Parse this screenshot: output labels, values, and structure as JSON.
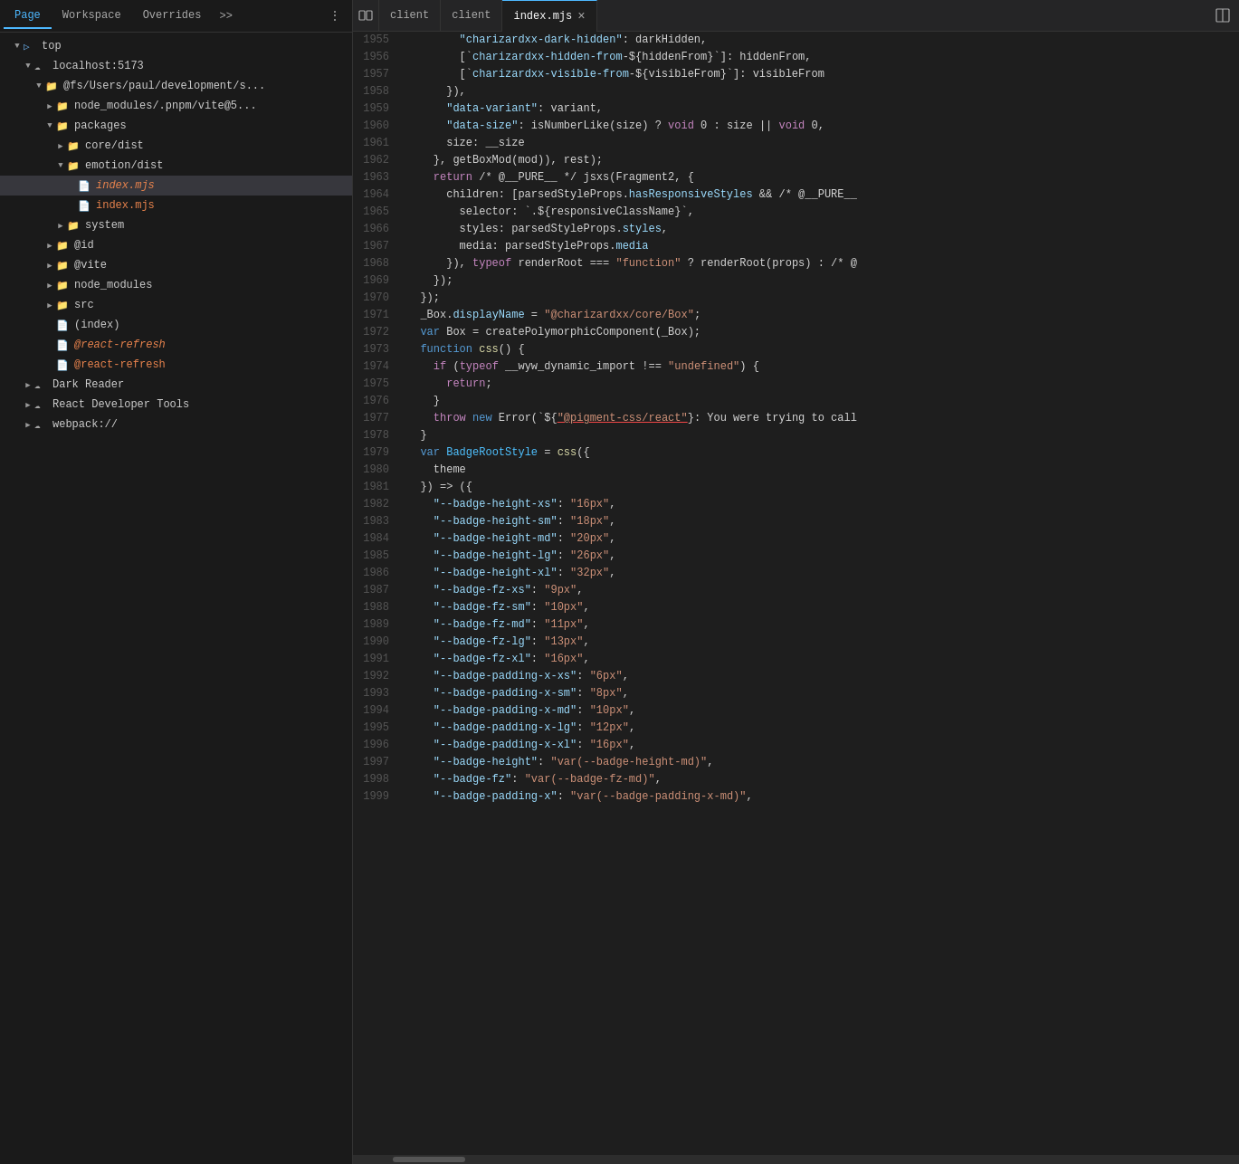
{
  "tabs": {
    "items": [
      {
        "label": "Page",
        "active": true
      },
      {
        "label": "Workspace",
        "active": false
      },
      {
        "label": "Overrides",
        "active": false
      }
    ],
    "more": ">>",
    "dots": "⋮"
  },
  "fileTree": {
    "items": [
      {
        "indent": 0,
        "arrow": "▼",
        "icon": "folder",
        "label": "top",
        "selected": false
      },
      {
        "indent": 1,
        "arrow": "▼",
        "icon": "cloud",
        "label": "localhost:5173",
        "selected": false
      },
      {
        "indent": 2,
        "arrow": "▼",
        "icon": "folder",
        "label": "@fs/Users/paul/development/s...",
        "selected": false
      },
      {
        "indent": 3,
        "arrow": "▶",
        "icon": "folder",
        "label": "node_modules/.pnpm/vite@5...",
        "selected": false
      },
      {
        "indent": 3,
        "arrow": "▼",
        "icon": "folder",
        "label": "packages",
        "selected": false
      },
      {
        "indent": 4,
        "arrow": "▶",
        "icon": "folder",
        "label": "core/dist",
        "selected": false
      },
      {
        "indent": 4,
        "arrow": "▼",
        "icon": "folder",
        "label": "emotion/dist",
        "selected": false
      },
      {
        "indent": 5,
        "arrow": "",
        "icon": "file-orange",
        "label": "index.mjs",
        "selected": true,
        "italic": true
      },
      {
        "indent": 5,
        "arrow": "",
        "icon": "file-orange",
        "label": "index.mjs",
        "selected": false
      },
      {
        "indent": 4,
        "arrow": "▶",
        "icon": "folder",
        "label": "system",
        "selected": false
      },
      {
        "indent": 3,
        "arrow": "▶",
        "icon": "folder",
        "label": "@id",
        "selected": false
      },
      {
        "indent": 3,
        "arrow": "▶",
        "icon": "folder",
        "label": "@vite",
        "selected": false
      },
      {
        "indent": 3,
        "arrow": "▶",
        "icon": "folder",
        "label": "node_modules",
        "selected": false
      },
      {
        "indent": 3,
        "arrow": "▶",
        "icon": "folder",
        "label": "src",
        "selected": false
      },
      {
        "indent": 3,
        "arrow": "",
        "icon": "file",
        "label": "(index)",
        "selected": false
      },
      {
        "indent": 3,
        "arrow": "",
        "icon": "file-orange",
        "label": "@react-refresh",
        "selected": false,
        "italic": true
      },
      {
        "indent": 3,
        "arrow": "",
        "icon": "file-orange",
        "label": "@react-refresh",
        "selected": false
      },
      {
        "indent": 1,
        "arrow": "▶",
        "icon": "cloud",
        "label": "Dark Reader",
        "selected": false
      },
      {
        "indent": 1,
        "arrow": "▶",
        "icon": "cloud",
        "label": "React Developer Tools",
        "selected": false
      },
      {
        "indent": 1,
        "arrow": "▶",
        "icon": "cloud",
        "label": "webpack://",
        "selected": false
      }
    ]
  },
  "editorTabs": {
    "layoutIcon": "⊞",
    "tabs": [
      {
        "label": "client",
        "active": false,
        "closable": false
      },
      {
        "label": "client",
        "active": false,
        "closable": false
      },
      {
        "label": "index.mjs",
        "active": true,
        "closable": true
      }
    ]
  },
  "codeLines": [
    {
      "num": 1955,
      "content": [
        {
          "t": "        ",
          "c": ""
        },
        {
          "t": "\"charizardxx-dark-hidden\"",
          "c": "s-key"
        },
        {
          "t": ": darkHidden,",
          "c": "s-white"
        }
      ]
    },
    {
      "num": 1956,
      "content": [
        {
          "t": "        [`",
          "c": "s-white"
        },
        {
          "t": "charizardxx-hidden-from",
          "c": "s-key"
        },
        {
          "t": "-${hiddenFrom}`]: hiddenFrom,",
          "c": "s-white"
        }
      ]
    },
    {
      "num": 1957,
      "content": [
        {
          "t": "        [`",
          "c": "s-white"
        },
        {
          "t": "charizardxx-visible-from",
          "c": "s-key"
        },
        {
          "t": "-${visibleFrom}`]: visibleFrom",
          "c": "s-white"
        }
      ]
    },
    {
      "num": 1958,
      "content": [
        {
          "t": "      }),",
          "c": "s-white"
        }
      ]
    },
    {
      "num": 1959,
      "content": [
        {
          "t": "      ",
          "c": ""
        },
        {
          "t": "\"data-variant\"",
          "c": "s-key"
        },
        {
          "t": ": variant,",
          "c": "s-white"
        }
      ]
    },
    {
      "num": 1960,
      "content": [
        {
          "t": "      ",
          "c": ""
        },
        {
          "t": "\"data-size\"",
          "c": "s-key"
        },
        {
          "t": ": isNumberLike(size) ? ",
          "c": "s-white"
        },
        {
          "t": "void",
          "c": "s-keyword"
        },
        {
          "t": " 0 : size || ",
          "c": "s-white"
        },
        {
          "t": "void",
          "c": "s-keyword"
        },
        {
          "t": " 0,",
          "c": "s-white"
        }
      ]
    },
    {
      "num": 1961,
      "content": [
        {
          "t": "      size: __size",
          "c": "s-white"
        }
      ]
    },
    {
      "num": 1962,
      "content": [
        {
          "t": "    }, getBoxMod(mod)), rest);",
          "c": "s-white"
        }
      ]
    },
    {
      "num": 1963,
      "content": [
        {
          "t": "    ",
          "c": ""
        },
        {
          "t": "return",
          "c": "s-keyword"
        },
        {
          "t": " /* @__PURE__ */ jsxs(Fragment2, {",
          "c": "s-white"
        }
      ]
    },
    {
      "num": 1964,
      "content": [
        {
          "t": "      children: [parsedStyleProps.",
          "c": "s-white"
        },
        {
          "t": "hasResponsiveStyles",
          "c": "s-prop"
        },
        {
          "t": " && /* @__PURE__",
          "c": "s-white"
        }
      ]
    },
    {
      "num": 1965,
      "content": [
        {
          "t": "        selector: `.",
          "c": "s-white"
        },
        {
          "t": "${responsiveClassName}",
          "c": "s-white"
        },
        {
          "t": "`,",
          "c": "s-white"
        }
      ]
    },
    {
      "num": 1966,
      "content": [
        {
          "t": "        styles: parsedStyleProps.",
          "c": "s-white"
        },
        {
          "t": "styles",
          "c": "s-prop"
        },
        {
          "t": ",",
          "c": "s-white"
        }
      ]
    },
    {
      "num": 1967,
      "content": [
        {
          "t": "        media: parsedStyleProps.",
          "c": "s-white"
        },
        {
          "t": "media",
          "c": "s-prop"
        }
      ]
    },
    {
      "num": 1968,
      "content": [
        {
          "t": "      }), ",
          "c": "s-white"
        },
        {
          "t": "typeof",
          "c": "s-keyword"
        },
        {
          "t": " renderRoot === ",
          "c": "s-white"
        },
        {
          "t": "\"function\"",
          "c": "s-string"
        },
        {
          "t": " ? renderRoot(props) : /* @",
          "c": "s-white"
        }
      ]
    },
    {
      "num": 1969,
      "content": [
        {
          "t": "    });",
          "c": "s-white"
        }
      ]
    },
    {
      "num": 1970,
      "content": [
        {
          "t": "  });",
          "c": "s-white"
        }
      ]
    },
    {
      "num": 1971,
      "content": [
        {
          "t": "  _Box.",
          "c": "s-white"
        },
        {
          "t": "displayName",
          "c": "s-prop"
        },
        {
          "t": " = ",
          "c": "s-white"
        },
        {
          "t": "\"@charizardxx/core/Box\"",
          "c": "s-string"
        },
        {
          "t": ";",
          "c": "s-white"
        }
      ]
    },
    {
      "num": 1972,
      "content": [
        {
          "t": "  ",
          "c": ""
        },
        {
          "t": "var",
          "c": "s-keyword-blue"
        },
        {
          "t": " Box = createPolymorphicComponent(_Box);",
          "c": "s-white"
        }
      ]
    },
    {
      "num": 1973,
      "content": [
        {
          "t": "  ",
          "c": ""
        },
        {
          "t": "function",
          "c": "s-keyword-blue"
        },
        {
          "t": " ",
          "c": ""
        },
        {
          "t": "css",
          "c": "s-func"
        },
        {
          "t": "() {",
          "c": "s-white"
        }
      ]
    },
    {
      "num": 1974,
      "content": [
        {
          "t": "    ",
          "c": ""
        },
        {
          "t": "if",
          "c": "s-keyword"
        },
        {
          "t": " (",
          "c": "s-white"
        },
        {
          "t": "typeof",
          "c": "s-keyword"
        },
        {
          "t": " __wyw_dynamic_import !== ",
          "c": "s-white"
        },
        {
          "t": "\"undefined\"",
          "c": "s-string"
        },
        {
          "t": ") {",
          "c": "s-white"
        }
      ]
    },
    {
      "num": 1975,
      "content": [
        {
          "t": "      ",
          "c": ""
        },
        {
          "t": "return",
          "c": "s-keyword"
        },
        {
          "t": ";",
          "c": "s-white"
        }
      ]
    },
    {
      "num": 1976,
      "content": [
        {
          "t": "    }",
          "c": "s-white"
        }
      ]
    },
    {
      "num": 1977,
      "content": [
        {
          "t": "    ",
          "c": ""
        },
        {
          "t": "throw",
          "c": "s-keyword"
        },
        {
          "t": " ",
          "c": ""
        },
        {
          "t": "new",
          "c": "s-keyword-blue"
        },
        {
          "t": " Error(`${",
          "c": "s-white"
        },
        {
          "t": "\"@pigment-css/react\"",
          "c": "s-string underline-red"
        },
        {
          "t": "}: You were trying to call",
          "c": "s-white"
        }
      ]
    },
    {
      "num": 1978,
      "content": [
        {
          "t": "  }",
          "c": "s-white"
        }
      ]
    },
    {
      "num": 1979,
      "content": [
        {
          "t": "  ",
          "c": ""
        },
        {
          "t": "var",
          "c": "s-keyword-blue"
        },
        {
          "t": " ",
          "c": ""
        },
        {
          "t": "BadgeRootStyle",
          "c": "s-var"
        },
        {
          "t": " = ",
          "c": "s-white"
        },
        {
          "t": "css",
          "c": "s-func"
        },
        {
          "t": "({",
          "c": "s-white"
        }
      ]
    },
    {
      "num": 1980,
      "content": [
        {
          "t": "    theme",
          "c": "s-white"
        }
      ]
    },
    {
      "num": 1981,
      "content": [
        {
          "t": "  }) => ({",
          "c": "s-white"
        }
      ]
    },
    {
      "num": 1982,
      "content": [
        {
          "t": "    ",
          "c": ""
        },
        {
          "t": "\"--badge-height-xs\"",
          "c": "s-key"
        },
        {
          "t": ": ",
          "c": "s-white"
        },
        {
          "t": "\"16px\"",
          "c": "s-string"
        },
        {
          "t": ",",
          "c": "s-white"
        }
      ]
    },
    {
      "num": 1983,
      "content": [
        {
          "t": "    ",
          "c": ""
        },
        {
          "t": "\"--badge-height-sm\"",
          "c": "s-key"
        },
        {
          "t": ": ",
          "c": "s-white"
        },
        {
          "t": "\"18px\"",
          "c": "s-string"
        },
        {
          "t": ",",
          "c": "s-white"
        }
      ]
    },
    {
      "num": 1984,
      "content": [
        {
          "t": "    ",
          "c": ""
        },
        {
          "t": "\"--badge-height-md\"",
          "c": "s-key"
        },
        {
          "t": ": ",
          "c": "s-white"
        },
        {
          "t": "\"20px\"",
          "c": "s-string"
        },
        {
          "t": ",",
          "c": "s-white"
        }
      ]
    },
    {
      "num": 1985,
      "content": [
        {
          "t": "    ",
          "c": ""
        },
        {
          "t": "\"--badge-height-lg\"",
          "c": "s-key"
        },
        {
          "t": ": ",
          "c": "s-white"
        },
        {
          "t": "\"26px\"",
          "c": "s-string"
        },
        {
          "t": ",",
          "c": "s-white"
        }
      ]
    },
    {
      "num": 1986,
      "content": [
        {
          "t": "    ",
          "c": ""
        },
        {
          "t": "\"--badge-height-xl\"",
          "c": "s-key"
        },
        {
          "t": ": ",
          "c": "s-white"
        },
        {
          "t": "\"32px\"",
          "c": "s-string"
        },
        {
          "t": ",",
          "c": "s-white"
        }
      ]
    },
    {
      "num": 1987,
      "content": [
        {
          "t": "    ",
          "c": ""
        },
        {
          "t": "\"--badge-fz-xs\"",
          "c": "s-key"
        },
        {
          "t": ": ",
          "c": "s-white"
        },
        {
          "t": "\"9px\"",
          "c": "s-string"
        },
        {
          "t": ",",
          "c": "s-white"
        }
      ]
    },
    {
      "num": 1988,
      "content": [
        {
          "t": "    ",
          "c": ""
        },
        {
          "t": "\"--badge-fz-sm\"",
          "c": "s-key"
        },
        {
          "t": ": ",
          "c": "s-white"
        },
        {
          "t": "\"10px\"",
          "c": "s-string"
        },
        {
          "t": ",",
          "c": "s-white"
        }
      ]
    },
    {
      "num": 1989,
      "content": [
        {
          "t": "    ",
          "c": ""
        },
        {
          "t": "\"--badge-fz-md\"",
          "c": "s-key"
        },
        {
          "t": ": ",
          "c": "s-white"
        },
        {
          "t": "\"11px\"",
          "c": "s-string"
        },
        {
          "t": ",",
          "c": "s-white"
        }
      ]
    },
    {
      "num": 1990,
      "content": [
        {
          "t": "    ",
          "c": ""
        },
        {
          "t": "\"--badge-fz-lg\"",
          "c": "s-key"
        },
        {
          "t": ": ",
          "c": "s-white"
        },
        {
          "t": "\"13px\"",
          "c": "s-string"
        },
        {
          "t": ",",
          "c": "s-white"
        }
      ]
    },
    {
      "num": 1991,
      "content": [
        {
          "t": "    ",
          "c": ""
        },
        {
          "t": "\"--badge-fz-xl\"",
          "c": "s-key"
        },
        {
          "t": ": ",
          "c": "s-white"
        },
        {
          "t": "\"16px\"",
          "c": "s-string"
        },
        {
          "t": ",",
          "c": "s-white"
        }
      ]
    },
    {
      "num": 1992,
      "content": [
        {
          "t": "    ",
          "c": ""
        },
        {
          "t": "\"--badge-padding-x-xs\"",
          "c": "s-key"
        },
        {
          "t": ": ",
          "c": "s-white"
        },
        {
          "t": "\"6px\"",
          "c": "s-string"
        },
        {
          "t": ",",
          "c": "s-white"
        }
      ]
    },
    {
      "num": 1993,
      "content": [
        {
          "t": "    ",
          "c": ""
        },
        {
          "t": "\"--badge-padding-x-sm\"",
          "c": "s-key"
        },
        {
          "t": ": ",
          "c": "s-white"
        },
        {
          "t": "\"8px\"",
          "c": "s-string"
        },
        {
          "t": ",",
          "c": "s-white"
        }
      ]
    },
    {
      "num": 1994,
      "content": [
        {
          "t": "    ",
          "c": ""
        },
        {
          "t": "\"--badge-padding-x-md\"",
          "c": "s-key"
        },
        {
          "t": ": ",
          "c": "s-white"
        },
        {
          "t": "\"10px\"",
          "c": "s-string"
        },
        {
          "t": ",",
          "c": "s-white"
        }
      ]
    },
    {
      "num": 1995,
      "content": [
        {
          "t": "    ",
          "c": ""
        },
        {
          "t": "\"--badge-padding-x-lg\"",
          "c": "s-key"
        },
        {
          "t": ": ",
          "c": "s-white"
        },
        {
          "t": "\"12px\"",
          "c": "s-string"
        },
        {
          "t": ",",
          "c": "s-white"
        }
      ]
    },
    {
      "num": 1996,
      "content": [
        {
          "t": "    ",
          "c": ""
        },
        {
          "t": "\"--badge-padding-x-xl\"",
          "c": "s-key"
        },
        {
          "t": ": ",
          "c": "s-white"
        },
        {
          "t": "\"16px\"",
          "c": "s-string"
        },
        {
          "t": ",",
          "c": "s-white"
        }
      ]
    },
    {
      "num": 1997,
      "content": [
        {
          "t": "    ",
          "c": ""
        },
        {
          "t": "\"--badge-height\"",
          "c": "s-key"
        },
        {
          "t": ": ",
          "c": "s-white"
        },
        {
          "t": "\"var(--badge-height-md)\"",
          "c": "s-string"
        },
        {
          "t": ",",
          "c": "s-white"
        }
      ]
    },
    {
      "num": 1998,
      "content": [
        {
          "t": "    ",
          "c": ""
        },
        {
          "t": "\"--badge-fz\"",
          "c": "s-key"
        },
        {
          "t": ": ",
          "c": "s-white"
        },
        {
          "t": "\"var(--badge-fz-md)\"",
          "c": "s-string"
        },
        {
          "t": ",",
          "c": "s-white"
        }
      ]
    },
    {
      "num": 1999,
      "content": [
        {
          "t": "    ",
          "c": ""
        },
        {
          "t": "\"--badge-padding-x\"",
          "c": "s-key"
        },
        {
          "t": ": ",
          "c": "s-white"
        },
        {
          "t": "\"var(--badge-padding-x-md)\"",
          "c": "s-string"
        },
        {
          "t": ",",
          "c": "s-white"
        }
      ]
    }
  ]
}
